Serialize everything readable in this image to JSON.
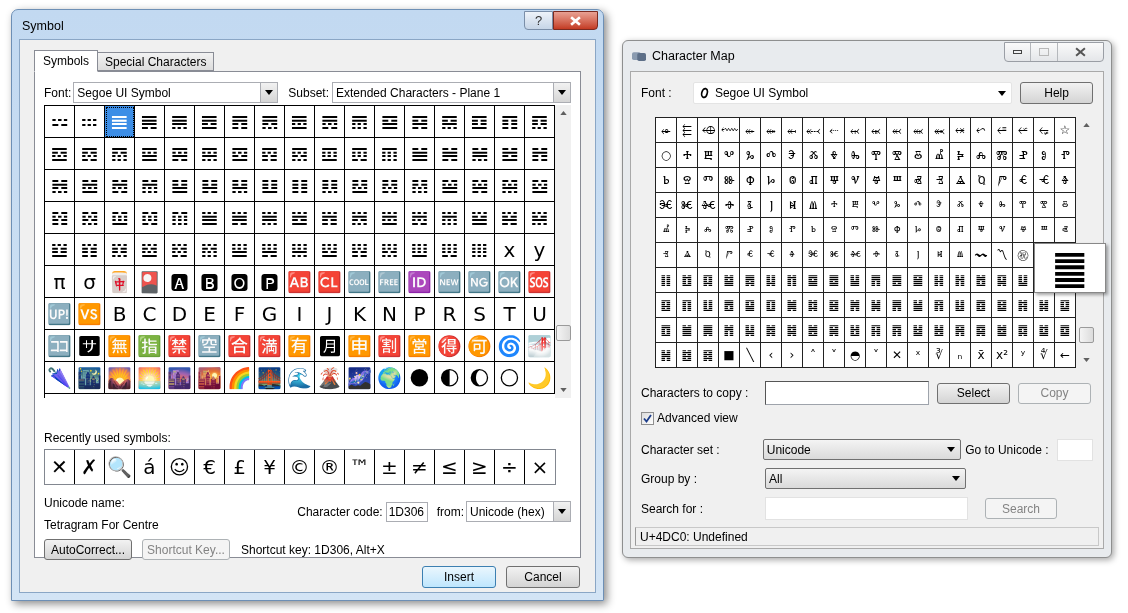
{
  "symbol_dialog": {
    "title": "Symbol",
    "help_button": "?",
    "tabs": [
      {
        "label": "Symbols",
        "selected": true
      },
      {
        "label": "Special Characters",
        "selected": false
      }
    ],
    "font": {
      "label": "Font:",
      "value": "Segoe UI Symbol"
    },
    "subset": {
      "label": "Subset:",
      "value": "Extended Characters - Plane 1"
    },
    "grid": [
      [
        {
          "ch": "𝌄",
          "selected": false
        },
        {
          "ch": "𝌅",
          "selected": false
        },
        {
          "ch": "𝌆",
          "selected": true
        },
        {
          "ch": "𝌇",
          "selected": false
        },
        {
          "ch": "𝌈",
          "selected": false
        },
        {
          "ch": "𝌉",
          "selected": false
        },
        {
          "ch": "𝌊",
          "selected": false
        },
        {
          "ch": "𝌋",
          "selected": false
        },
        {
          "ch": "𝌌",
          "selected": false
        },
        {
          "ch": "𝌍",
          "selected": false
        },
        {
          "ch": "𝌎",
          "selected": false
        },
        {
          "ch": "𝌏",
          "selected": false
        },
        {
          "ch": "𝌐",
          "selected": false
        },
        {
          "ch": "𝌑",
          "selected": false
        },
        {
          "ch": "𝌒",
          "selected": false
        },
        {
          "ch": "𝌓",
          "selected": false
        },
        {
          "ch": "𝌔",
          "selected": false
        }
      ],
      [
        {
          "ch": "𝌕",
          "selected": false
        },
        {
          "ch": "𝌖",
          "selected": false
        },
        {
          "ch": "𝌗",
          "selected": false
        },
        {
          "ch": "𝌘",
          "selected": false
        },
        {
          "ch": "𝌙",
          "selected": false
        },
        {
          "ch": "𝌚",
          "selected": false
        },
        {
          "ch": "𝌛",
          "selected": false
        },
        {
          "ch": "𝌜",
          "selected": false
        },
        {
          "ch": "𝌝",
          "selected": false
        },
        {
          "ch": "𝌞",
          "selected": false
        },
        {
          "ch": "𝌟",
          "selected": false
        },
        {
          "ch": "𝌠",
          "selected": false
        },
        {
          "ch": "𝌡",
          "selected": false
        },
        {
          "ch": "𝌢",
          "selected": false
        },
        {
          "ch": "𝌣",
          "selected": false
        },
        {
          "ch": "𝌤",
          "selected": false
        },
        {
          "ch": "𝌥",
          "selected": false
        }
      ],
      [
        {
          "ch": "𝌦",
          "selected": false
        },
        {
          "ch": "𝌧",
          "selected": false
        },
        {
          "ch": "𝌨",
          "selected": false
        },
        {
          "ch": "𝌩",
          "selected": false
        },
        {
          "ch": "𝌪",
          "selected": false
        },
        {
          "ch": "𝌫",
          "selected": false
        },
        {
          "ch": "𝌬",
          "selected": false
        },
        {
          "ch": "𝌭",
          "selected": false
        },
        {
          "ch": "𝌮",
          "selected": false
        },
        {
          "ch": "𝌯",
          "selected": false
        },
        {
          "ch": "𝌰",
          "selected": false
        },
        {
          "ch": "𝌱",
          "selected": false
        },
        {
          "ch": "𝌲",
          "selected": false
        },
        {
          "ch": "𝌳",
          "selected": false
        },
        {
          "ch": "𝌴",
          "selected": false
        },
        {
          "ch": "𝌵",
          "selected": false
        },
        {
          "ch": "𝌶",
          "selected": false
        }
      ],
      [
        {
          "ch": "𝌷",
          "selected": false
        },
        {
          "ch": "𝌸",
          "selected": false
        },
        {
          "ch": "𝌹",
          "selected": false
        },
        {
          "ch": "𝌺",
          "selected": false
        },
        {
          "ch": "𝌻",
          "selected": false
        },
        {
          "ch": "𝌼",
          "selected": false
        },
        {
          "ch": "𝌽",
          "selected": false
        },
        {
          "ch": "𝌾",
          "selected": false
        },
        {
          "ch": "𝌿",
          "selected": false
        },
        {
          "ch": "𝍀",
          "selected": false
        },
        {
          "ch": "𝍁",
          "selected": false
        },
        {
          "ch": "𝍂",
          "selected": false
        },
        {
          "ch": "𝍃",
          "selected": false
        },
        {
          "ch": "𝍄",
          "selected": false
        },
        {
          "ch": "𝍅",
          "selected": false
        },
        {
          "ch": "𝍆",
          "selected": false
        },
        {
          "ch": "𝍇",
          "selected": false
        }
      ],
      [
        {
          "ch": "𝍈",
          "selected": false
        },
        {
          "ch": "𝍉",
          "selected": false
        },
        {
          "ch": "𝍊",
          "selected": false
        },
        {
          "ch": "𝍋",
          "selected": false
        },
        {
          "ch": "𝍌",
          "selected": false
        },
        {
          "ch": "𝍍",
          "selected": false
        },
        {
          "ch": "𝍎",
          "selected": false
        },
        {
          "ch": "𝍏",
          "selected": false
        },
        {
          "ch": "𝍐",
          "selected": false
        },
        {
          "ch": "𝍑",
          "selected": false
        },
        {
          "ch": "𝍒",
          "selected": false
        },
        {
          "ch": "𝍓",
          "selected": false
        },
        {
          "ch": "𝍔",
          "selected": false
        },
        {
          "ch": "𝍕",
          "selected": false
        },
        {
          "ch": "𝍖",
          "selected": false
        },
        {
          "ch": "x",
          "selected": false
        },
        {
          "ch": "y",
          "selected": false
        }
      ],
      [
        {
          "ch": "π",
          "selected": false
        },
        {
          "ch": "σ",
          "selected": false
        },
        {
          "ch": "🀄",
          "selected": false
        },
        {
          "ch": "🎴",
          "selected": false
        },
        {
          "ch": "🅰",
          "selected": false
        },
        {
          "ch": "🅱",
          "selected": false
        },
        {
          "ch": "🅾",
          "selected": false
        },
        {
          "ch": "🅿",
          "selected": false
        },
        {
          "ch": "🆎",
          "selected": false
        },
        {
          "ch": "🆑",
          "selected": false
        },
        {
          "ch": "🆒",
          "selected": false
        },
        {
          "ch": "🆓",
          "selected": false
        },
        {
          "ch": "🆔",
          "selected": false
        },
        {
          "ch": "🆕",
          "selected": false
        },
        {
          "ch": "🆖",
          "selected": false
        },
        {
          "ch": "🆗",
          "selected": false
        },
        {
          "ch": "🆘",
          "selected": false
        }
      ],
      [
        {
          "ch": "🆙",
          "selected": false
        },
        {
          "ch": "🆚",
          "selected": false
        },
        {
          "ch": "B",
          "selected": false
        },
        {
          "ch": "C",
          "selected": false
        },
        {
          "ch": "D",
          "selected": false
        },
        {
          "ch": "E",
          "selected": false
        },
        {
          "ch": "F",
          "selected": false
        },
        {
          "ch": "G",
          "selected": false
        },
        {
          "ch": "I",
          "selected": false
        },
        {
          "ch": "J",
          "selected": false
        },
        {
          "ch": "K",
          "selected": false
        },
        {
          "ch": "N",
          "selected": false
        },
        {
          "ch": "P",
          "selected": false
        },
        {
          "ch": "R",
          "selected": false
        },
        {
          "ch": "S",
          "selected": false
        },
        {
          "ch": "T",
          "selected": false
        },
        {
          "ch": "U",
          "selected": false
        }
      ],
      [
        {
          "ch": "🈁",
          "selected": false
        },
        {
          "ch": "🈂",
          "selected": false
        },
        {
          "ch": "🈚",
          "selected": false
        },
        {
          "ch": "🈯",
          "selected": false
        },
        {
          "ch": "🈲",
          "selected": false
        },
        {
          "ch": "🈳",
          "selected": false
        },
        {
          "ch": "🈴",
          "selected": false
        },
        {
          "ch": "🈵",
          "selected": false
        },
        {
          "ch": "🈶",
          "selected": false
        },
        {
          "ch": "🈷",
          "selected": false
        },
        {
          "ch": "🈸",
          "selected": false
        },
        {
          "ch": "🈹",
          "selected": false
        },
        {
          "ch": "🈺",
          "selected": false
        },
        {
          "ch": "🉐",
          "selected": false
        },
        {
          "ch": "🉑",
          "selected": false
        },
        {
          "ch": "🌀",
          "selected": false
        },
        {
          "ch": "🌁",
          "selected": false
        }
      ],
      [
        {
          "ch": "🌂",
          "selected": false
        },
        {
          "ch": "🌃",
          "selected": false
        },
        {
          "ch": "🌄",
          "selected": false
        },
        {
          "ch": "🌅",
          "selected": false
        },
        {
          "ch": "🌆",
          "selected": false
        },
        {
          "ch": "🌇",
          "selected": false
        },
        {
          "ch": "🌈",
          "selected": false
        },
        {
          "ch": "🌉",
          "selected": false
        },
        {
          "ch": "🌊",
          "selected": false
        },
        {
          "ch": "🌋",
          "selected": false
        },
        {
          "ch": "🌌",
          "selected": false
        },
        {
          "ch": "🌍",
          "selected": false
        },
        {
          "ch": "🌑",
          "selected": false
        },
        {
          "ch": "🌓",
          "selected": false
        },
        {
          "ch": "🌔",
          "selected": false
        },
        {
          "ch": "🌕",
          "selected": false
        },
        {
          "ch": "🌙",
          "selected": false
        }
      ]
    ],
    "recent_label": "Recently used symbols:",
    "recent": [
      "✕",
      "✗",
      "🔍",
      "á",
      "☺",
      "€",
      "£",
      "¥",
      "©",
      "®",
      "™",
      "±",
      "≠",
      "≤",
      "≥",
      "÷",
      "×"
    ],
    "unicode_name_label": "Unicode name:",
    "unicode_name": "Tetragram For Centre",
    "character_code": {
      "label": "Character code:",
      "value": "1D306"
    },
    "from": {
      "label": "from:",
      "value": "Unicode (hex)"
    },
    "tool_buttons": [
      {
        "label": "AutoCorrect...",
        "disabled": false
      },
      {
        "label": "Shortcut Key...",
        "disabled": true
      }
    ],
    "shortcut_text": "Shortcut key: 1D306, Alt+X",
    "dialog_buttons": [
      {
        "label": "Insert",
        "default": true
      },
      {
        "label": "Cancel",
        "default": false
      }
    ]
  },
  "charmap": {
    "title": "Character Map",
    "font": {
      "label": "Font :",
      "value": "Segoe UI Symbol"
    },
    "help_button": "Help",
    "grid": [
      [
        "⬰",
        "⬱",
        "⬲",
        "⬳",
        "⬴",
        "⬵",
        "⬶",
        "⬷",
        "⬸",
        "⬹",
        "⬺",
        "⬻",
        "⬼",
        "⬽",
        "⬾",
        "⬿",
        "⭀",
        "⭁",
        "⭂",
        "☆"
      ],
      [
        "○",
        "Ⰰ",
        "Ⰱ",
        "Ⰲ",
        "Ⰳ",
        "Ⰴ",
        "Ⰵ",
        "Ⰶ",
        "Ⰷ",
        "Ⰸ",
        "Ⰹ",
        "Ⰺ",
        "Ⰻ",
        "Ⰼ",
        "Ⰽ",
        "Ⰾ",
        "Ⰿ",
        "Ⱀ",
        "Ⱁ",
        "Ⱂ"
      ],
      [
        "Ⱃ",
        "Ⱄ",
        "Ⱅ",
        "Ⱆ",
        "Ⱇ",
        "Ⱈ",
        "Ⱉ",
        "Ⱊ",
        "Ⱋ",
        "Ⱌ",
        "Ⱍ",
        "Ⱎ",
        "Ⱏ",
        "Ⱐ",
        "Ⱑ",
        "Ⱒ",
        "Ⱓ",
        "Ⱔ",
        "Ⱕ",
        "Ⱖ"
      ],
      [
        "Ⱗ",
        "Ⱘ",
        "Ⱙ",
        "Ⱚ",
        "Ⱛ",
        "Ⱜ",
        "Ⱝ",
        "Ⱞ",
        "ⰰ",
        "ⰱ",
        "ⰲ",
        "ⰳ",
        "ⰴ",
        "ⰵ",
        "ⰶ",
        "ⰷ",
        "ⰸ",
        "ⰹ",
        "ⰺ",
        "ⰻ"
      ],
      [
        "ⰼ",
        "ⰽ",
        "ⰾ",
        "ⰿ",
        "ⱀ",
        "ⱁ",
        "ⱂ",
        "ⱃ",
        "ⱄ",
        "ⱅ",
        "ⱆ",
        "ⱇ",
        "ⱈ",
        "ⱉ",
        "ⱊ",
        "ⱋ",
        "ⱌ",
        "ⱍ",
        "ⱎ",
        "ⱏ"
      ],
      [
        "ⱐ",
        "ⱑ",
        "ⱒ",
        "ⱓ",
        "ⱔ",
        "ⱕ",
        "ⱖ",
        "ⱗ",
        "ⱘ",
        "ⱙ",
        "ⱚ",
        "ⱛ",
        "ⱜ",
        "ⱝ",
        "ⱞ",
        "〰",
        "〽",
        "㊗"
      ],
      [
        "䷁",
        "䷂",
        "䷃",
        "䷄",
        "䷅",
        "䷆",
        "䷇",
        "䷈",
        "䷉",
        "䷊",
        "䷋",
        "䷌",
        "䷍",
        "䷎",
        "䷏",
        "䷐",
        "䷑",
        "䷒"
      ],
      [
        "䷕",
        "䷖",
        "䷗",
        "䷘",
        "䷙",
        "䷚",
        "䷛",
        "䷜",
        "䷝",
        "䷞",
        "䷟",
        "䷠",
        "䷡",
        "䷢",
        "䷣",
        "䷤",
        "䷥",
        "䷦",
        "䷧",
        "䷨"
      ],
      [
        "䷩",
        "䷪",
        "䷫",
        "䷬",
        "䷭",
        "䷮",
        "䷯",
        "䷰",
        "䷱",
        "䷲",
        "䷳",
        "䷴",
        "䷵",
        "䷶",
        "䷷",
        "䷸",
        "䷹",
        "䷺",
        "䷻",
        "䷼"
      ],
      [
        "䷽",
        "䷾",
        "䷿",
        "■",
        "╲",
        "‹",
        "›",
        "˄",
        "˅",
        "◓",
        "˅",
        "✕",
        "ˣ",
        "∛",
        "ₙ",
        "x̄",
        "x²",
        "ʸ",
        "∜",
        "←"
      ]
    ],
    "magnified": "䷀",
    "chars_to_copy_label": "Characters to copy :",
    "select_button": "Select",
    "copy_button": {
      "label": "Copy",
      "disabled": true
    },
    "advanced_view": {
      "label": "Advanced view",
      "checked": true
    },
    "character_set": {
      "label": "Character set :",
      "value": "Unicode"
    },
    "go_to_unicode_label": "Go to Unicode :",
    "group_by": {
      "label": "Group by :",
      "value": "All"
    },
    "search_label": "Search for :",
    "search_button": {
      "label": "Search",
      "disabled": true
    },
    "status": "U+4DC0: Undefined"
  }
}
